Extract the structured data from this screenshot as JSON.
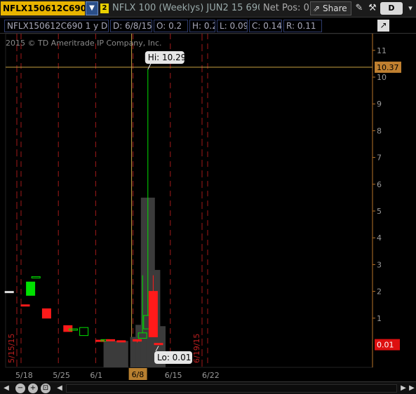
{
  "toolbar": {
    "symbol": "NFLX150612C690",
    "symbol_dropdown_icon": "chevron-double-down-icon",
    "link_badge": "2",
    "description": "NFLX 100 (Weeklys) JUN2 15 690...",
    "net_pos": "Net Pos: 0",
    "share_label": "Share",
    "share_icon": "share-icon",
    "draw_icon": "drawing-tools-icon",
    "tools_icon": "wrench-icon",
    "detail_label": "D",
    "menu_icon": "menu-icon"
  },
  "info_bar": {
    "symbol_period": "NFLX150612C690 1 y D",
    "date": "D: 6/8/15",
    "open": "O: 0.2",
    "high": "H: 0.2",
    "low": "L: 0.09",
    "close": "C: 0.14",
    "range": "R: 0.11",
    "studies_icon": "studies-icon"
  },
  "copyright": "2015 © TD Ameritrade IP Company, Inc.",
  "colors": {
    "up": "#00e000",
    "down": "#ff1a1a",
    "axis": "#b8732a",
    "grid": "#a11a1a",
    "volume": "#3b3b3b",
    "crosshair": "#c8a040",
    "symbol_bg": "#e8b400"
  },
  "chart_data": {
    "type": "candlestick",
    "y_axis": {
      "side": "right",
      "ticks": [
        "1",
        "2",
        "3",
        "4",
        "5",
        "6",
        "7",
        "8",
        "9",
        "10",
        "11"
      ],
      "min": 0,
      "max": 11
    },
    "x_axis": {
      "ticks": [
        "5/18",
        "5/25",
        "6/1",
        "6/8",
        "6/15",
        "6/22"
      ]
    },
    "expiry_markers": [
      "5/15/15",
      "6/19/15"
    ],
    "high_label": "Hi: 10.29",
    "low_label": "Lo: 0.01",
    "crosshair_price": "10.37",
    "last_price": "0.01",
    "crosshair_date": "6/8",
    "candles": [
      {
        "date": "5/15",
        "open": 2.0,
        "high": 2.0,
        "low": 2.0,
        "close": 2.0,
        "dir": "flat"
      },
      {
        "date": "5/18",
        "open": 1.5,
        "high": 1.5,
        "low": 1.45,
        "close": 1.45,
        "dir": "down"
      },
      {
        "date": "5/19",
        "open": 1.85,
        "high": 2.35,
        "low": 1.85,
        "close": 2.35,
        "dir": "up"
      },
      {
        "date": "5/20",
        "open": 2.55,
        "high": 2.55,
        "low": 2.55,
        "close": 2.55,
        "dir": "up"
      },
      {
        "date": "5/22",
        "open": 1.35,
        "high": 1.35,
        "low": 1.0,
        "close": 1.0,
        "dir": "down"
      },
      {
        "date": "5/26",
        "open": 0.72,
        "high": 0.72,
        "low": 0.5,
        "close": 0.5,
        "dir": "down"
      },
      {
        "date": "5/27",
        "open": 0.6,
        "high": 0.6,
        "low": 0.6,
        "close": 0.6,
        "dir": "up"
      },
      {
        "date": "5/29",
        "open": 0.35,
        "high": 0.65,
        "low": 0.35,
        "close": 0.65,
        "dir": "up"
      },
      {
        "date": "6/1",
        "open": 0.18,
        "high": 0.18,
        "low": 0.15,
        "close": 0.15,
        "dir": "down"
      },
      {
        "date": "6/2",
        "open": 0.2,
        "high": 0.2,
        "low": 0.2,
        "close": 0.2,
        "dir": "up"
      },
      {
        "date": "6/3",
        "open": 0.2,
        "high": 0.2,
        "low": 0.15,
        "close": 0.15,
        "dir": "down"
      },
      {
        "date": "6/5",
        "open": 0.16,
        "high": 0.16,
        "low": 0.12,
        "close": 0.12,
        "dir": "down"
      },
      {
        "date": "6/8",
        "open": 0.2,
        "high": 0.2,
        "low": 0.09,
        "close": 0.14,
        "dir": "down"
      },
      {
        "date": "6/9",
        "open": 0.25,
        "high": 2.6,
        "low": 0.25,
        "close": 0.45,
        "dir": "up"
      },
      {
        "date": "6/10",
        "open": 0.6,
        "high": 10.29,
        "low": 0.6,
        "close": 1.1,
        "dir": "up"
      },
      {
        "date": "6/11",
        "open": 2.0,
        "high": 2.6,
        "low": 0.3,
        "close": 0.3,
        "dir": "down"
      },
      {
        "date": "6/12",
        "open": 0.06,
        "high": 0.06,
        "low": 0.01,
        "close": 0.01,
        "dir": "down"
      }
    ],
    "volume": [
      {
        "date": "6/3",
        "value": 0.15
      },
      {
        "date": "6/5",
        "value": 0.15
      },
      {
        "date": "6/8",
        "value": 0.3
      },
      {
        "date": "6/9",
        "value": 0.75
      },
      {
        "date": "6/10",
        "value": 5.5
      },
      {
        "date": "6/11",
        "value": 2.8
      },
      {
        "date": "6/12",
        "value": 0.7
      }
    ]
  },
  "scrollbar": {
    "left_arrow_icon": "arrow-left-icon",
    "zoom_out_icon": "zoom-out-icon",
    "zoom_in_icon": "zoom-in-icon",
    "fit_icon": "fit-icon",
    "back_icon": "arrow-left-small-icon",
    "forward_icon": "arrow-right-small-icon",
    "right_icon": "arrow-right-icon"
  }
}
